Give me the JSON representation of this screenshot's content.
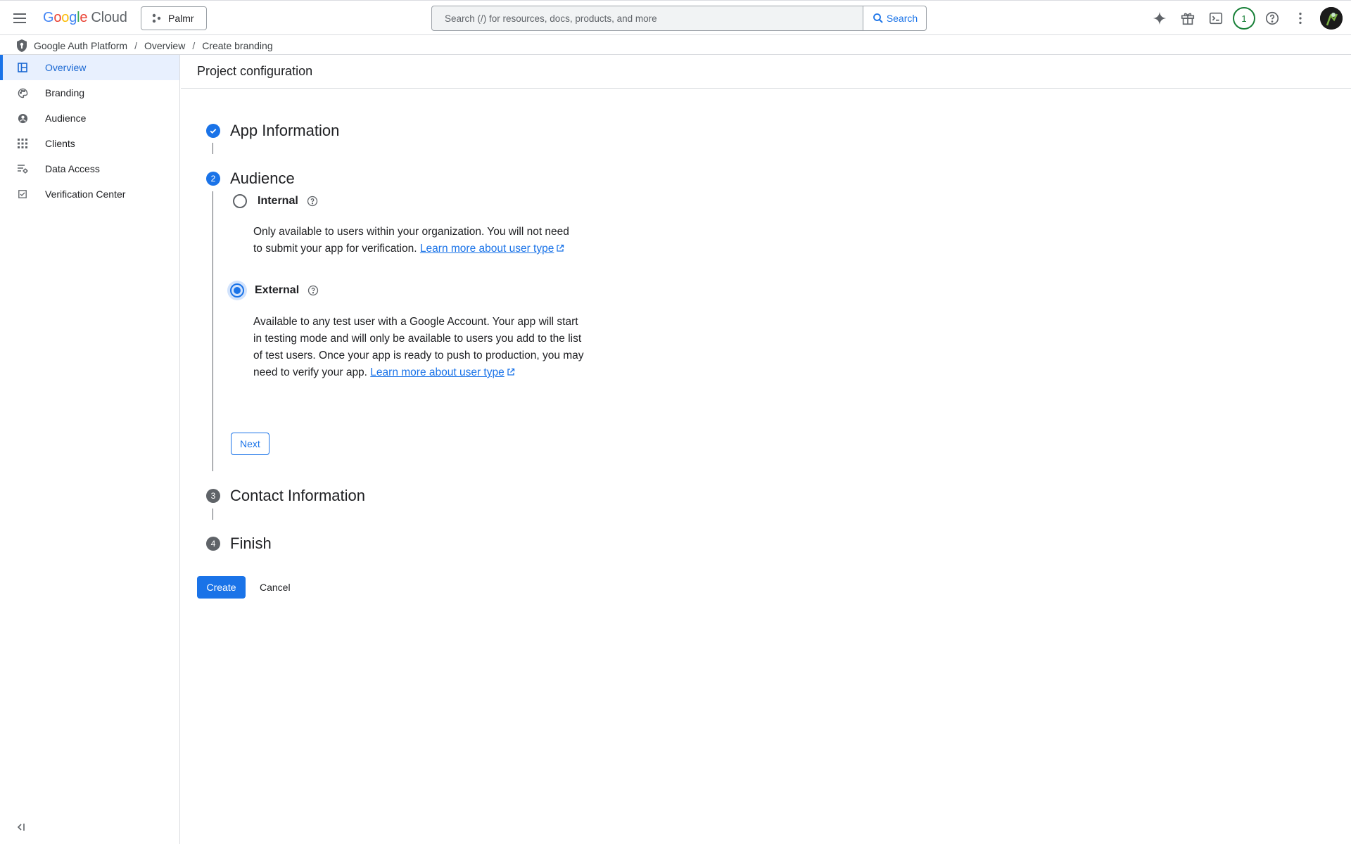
{
  "topbar": {
    "logo_letters": [
      "G",
      "o",
      "o",
      "g",
      "l",
      "e"
    ],
    "logo_suffix": "Cloud",
    "project_name": "Palmr",
    "search_placeholder": "Search (/) for resources, docs, products, and more",
    "search_button": "Search",
    "notification_count": "1"
  },
  "breadcrumb": {
    "items": [
      "Google Auth Platform",
      "Overview",
      "Create branding"
    ],
    "separator": "/"
  },
  "sidebar": {
    "items": [
      {
        "label": "Overview",
        "icon": "dashboard-icon",
        "active": true
      },
      {
        "label": "Branding",
        "icon": "palette-icon",
        "active": false
      },
      {
        "label": "Audience",
        "icon": "person-circle-icon",
        "active": false
      },
      {
        "label": "Clients",
        "icon": "grid-icon",
        "active": false
      },
      {
        "label": "Data Access",
        "icon": "list-settings-icon",
        "active": false
      },
      {
        "label": "Verification Center",
        "icon": "checkbox-icon",
        "active": false
      }
    ]
  },
  "main": {
    "page_title": "Project configuration",
    "steps": [
      {
        "number": "1",
        "title": "App Information",
        "state": "done"
      },
      {
        "number": "2",
        "title": "Audience",
        "state": "current"
      },
      {
        "number": "3",
        "title": "Contact Information",
        "state": "pending"
      },
      {
        "number": "4",
        "title": "Finish",
        "state": "pending"
      }
    ],
    "audience": {
      "internal": {
        "label": "Internal",
        "selected": false,
        "description": "Only available to users within your organization. You will not need to submit your app for verification. ",
        "link_text": "Learn more about user type"
      },
      "external": {
        "label": "External",
        "selected": true,
        "description": "Available to any test user with a Google Account. Your app will start in testing mode and will only be available to users you add to the list of test users. Once your app is ready to push to production, you may need to verify your app. ",
        "link_text": "Learn more about user type"
      },
      "next_label": "Next"
    },
    "create_label": "Create",
    "cancel_label": "Cancel"
  },
  "colors": {
    "accent": "#1a73e8",
    "active_nav_bg": "#e8f0fe",
    "notification": "#188038"
  }
}
